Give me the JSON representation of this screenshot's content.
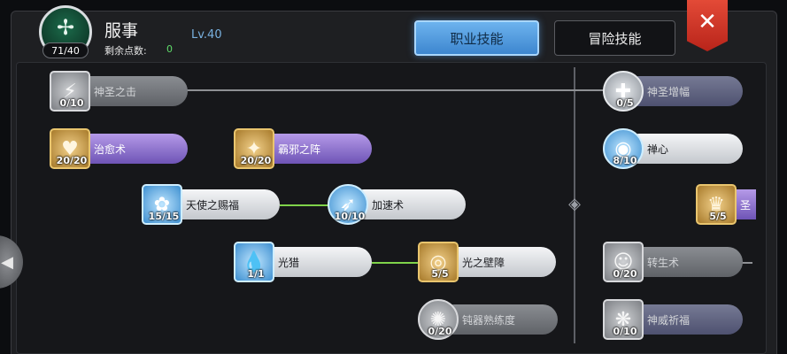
{
  "header": {
    "emblem_glyph": "✢",
    "job_level_progress": "71/40",
    "job_name": "服事",
    "job_level": "Lv.40",
    "points_label": "剩余点数:",
    "points_value": "0",
    "tabs": {
      "job_skills": "职业技能",
      "adventure_skills": "冒险技能"
    },
    "close_glyph": "✕"
  },
  "divider_glyph": "◈",
  "side_arrow_glyph": "◀",
  "skills": {
    "holy_strike": {
      "name": "神圣之击",
      "level": "0/10",
      "icon": "holy-strike-icon",
      "glyph": "⚡"
    },
    "heal": {
      "name": "治愈术",
      "level": "20/20",
      "icon": "heal-icon",
      "glyph": "♥"
    },
    "evil_banish": {
      "name": "霸邪之阵",
      "level": "20/20",
      "icon": "evil-banish-icon",
      "glyph": "✦"
    },
    "angel_blessing": {
      "name": "天使之赐福",
      "level": "15/15",
      "icon": "angel-blessing-icon",
      "glyph": "✿"
    },
    "haste": {
      "name": "加速术",
      "level": "10/10",
      "icon": "haste-icon",
      "glyph": "➶"
    },
    "light_hunt": {
      "name": "光猎",
      "level": "1/1",
      "icon": "light-hunt-icon",
      "glyph": "💧"
    },
    "light_barrier": {
      "name": "光之壁障",
      "level": "5/5",
      "icon": "light-barrier-icon",
      "glyph": "◎"
    },
    "blunt_mastery": {
      "name": "钝器熟练度",
      "level": "0/20",
      "icon": "blunt-mastery-icon",
      "glyph": "✺"
    },
    "holy_shield": {
      "name": "神圣增幅",
      "level": "0/5",
      "icon": "holy-cross-icon",
      "glyph": "✚"
    },
    "zen": {
      "name": "禅心",
      "level": "8/10",
      "icon": "zen-icon",
      "glyph": "◉"
    },
    "holy_partial": {
      "name": "圣",
      "level": "5/5",
      "icon": "holy-figure-icon",
      "glyph": "♛"
    },
    "resurrection": {
      "name": "转生术",
      "level": "0/20",
      "icon": "resurrection-icon",
      "glyph": "☺"
    },
    "divine_prayer": {
      "name": "神威祈福",
      "level": "0/10",
      "icon": "divine-prayer-icon",
      "glyph": "❋"
    }
  },
  "colors": {
    "accent_tab": "#4a95dd",
    "close": "#d0392b",
    "connector_active": "#7fd34a",
    "connector_locked": "#8e9094"
  }
}
